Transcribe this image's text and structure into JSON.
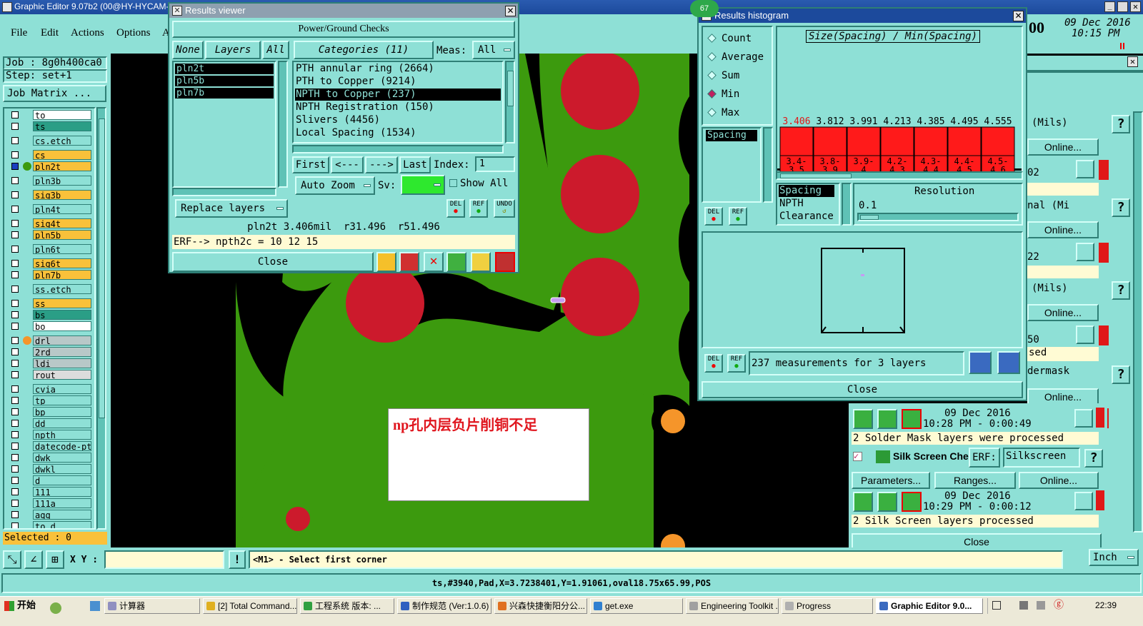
{
  "app": {
    "title": "Graphic Editor 9.07b2 (00@HY-HYCAM-(",
    "date": "09 Dec 2016",
    "time": "10:15 PM",
    "clock_partial": "00"
  },
  "menu": [
    "File",
    "Edit",
    "Actions",
    "Options",
    "Ar"
  ],
  "job": {
    "job": "Job : 8g0h400ca0",
    "step": "Step: set+1",
    "matrix": "Job Matrix ..."
  },
  "layers": [
    "to",
    "ts",
    "cs.etch",
    "cs",
    "pln2t",
    "pln3b",
    "sig3b",
    "pln4t",
    "sig4t",
    "pln5b",
    "pln6t",
    "sig6t",
    "pln7b",
    "ss.etch",
    "ss",
    "bs",
    "bo",
    "drl",
    "2rd",
    "ldi",
    "rout",
    "cvia",
    "tp",
    "bp",
    "dd",
    "npth",
    "datecode-pte",
    "dwk",
    "dwkl",
    "d",
    "111",
    "111a",
    "aqq",
    "to_d"
  ],
  "selected": "Selected : 0",
  "colors": {
    "desk": "#8ee0d6",
    "copper_green": "#3c9a0e",
    "pad_red": "#cc1a2c",
    "orange": "#f5952a",
    "bar_red": "#ff1a1a",
    "title_blue": "#1c4a9c"
  },
  "canvas": {
    "annotation": "np孔内层负片削铜不足"
  },
  "results_viewer": {
    "title": "Results viewer",
    "header": "Power/Ground Checks",
    "none": "None",
    "layers_btn": "Layers",
    "all": "All",
    "categories": "Categories (11)",
    "meas_label": "Meas:",
    "meas_value": "All",
    "layer_list": [
      "pln2t",
      "pln5b",
      "pln7b"
    ],
    "category_list": [
      "PTH annular ring (2664)",
      "PTH to Copper (9214)",
      "NPTH to Copper (237)",
      "NPTH Registration (150)",
      "Slivers (4456)",
      "Local Spacing (1534)"
    ],
    "nav": {
      "first": "First",
      "prev": "<---",
      "next": "--->",
      "last": "Last",
      "index_label": "Index:",
      "index_value": "1"
    },
    "auto_zoom": "Auto Zoom",
    "sv": "Sv:",
    "show_all": "Show All",
    "replace_layers": "Replace layers",
    "del": "DEL",
    "ref": "REF",
    "undo": "UNDO",
    "status": "pln2t 3.406mil  r31.496  r51.496",
    "erf": "ERF--> npth2c = 10 12 15",
    "close": "Close"
  },
  "histogram": {
    "title": "Results histogram",
    "badge": "67",
    "options": [
      "Count",
      "Average",
      "Sum",
      "Min",
      "Max"
    ],
    "selected_option": "Min",
    "chart_title": "Size(Spacing) / Min(Spacing)",
    "list_item": "Spacing",
    "types": [
      "Spacing",
      "NPTH",
      "Clearance"
    ],
    "resolution_label": "Resolution",
    "resolution_value": "0.1",
    "summary": "237 measurements for 3 layers",
    "close": "Close",
    "del": "DEL",
    "ref": "REF"
  },
  "chart_data": {
    "type": "bar",
    "title": "Size(Spacing) / Min(Spacing)",
    "categories": [
      "3.4-3.5",
      "3.8-3.9",
      "3.9-4",
      "4.2-4.3",
      "4.3-4.4",
      "4.4-4.5",
      "4.5-4.6"
    ],
    "values": [
      3.406,
      3.812,
      3.991,
      4.213,
      4.385,
      4.495,
      4.555
    ]
  },
  "right_panel": {
    "mils1": "(Mils)",
    "online": "Online...",
    "frag_02": "02",
    "frag_nal": "nal (Mi",
    "frag_22": "22",
    "mils2": "(Mils)",
    "frag_50": "50",
    "frag_sed": "sed",
    "frag_dermask": "dermask",
    "row1_date": "09 Dec 2016",
    "row1_time": "10:28 PM - 0:00:49",
    "row1_msg": "2 Solder Mask layers were processed",
    "silk_title": "Silk Screen Che",
    "erf": "ERF:",
    "silk_value": "Silkscreen",
    "parameters": "Parameters...",
    "ranges": "Ranges...",
    "row2_date": "09 Dec 2016",
    "row2_time": "10:29 PM - 0:00:12",
    "row2_msg": "2 Silk Screen layers processed",
    "close": "Close",
    "unit": "Inch",
    "help": "?"
  },
  "bottom": {
    "xy_label": "X Y :",
    "prompt": "<M1> - Select first corner",
    "status": "ts,#3940,Pad,X=3.7238401,Y=1.91061,oval18.75x65.99,POS"
  },
  "taskbar": {
    "start": "开始",
    "items": [
      "计算器",
      "[2] Total Command...",
      "工程系统 版本: ...",
      "制作规范 (Ver:1.0.6)",
      "兴森快捷衡阳分公...",
      "get.exe",
      "Engineering Toolkit ...",
      "Progress",
      "Graphic Editor 9.0..."
    ],
    "clock": "22:39"
  }
}
